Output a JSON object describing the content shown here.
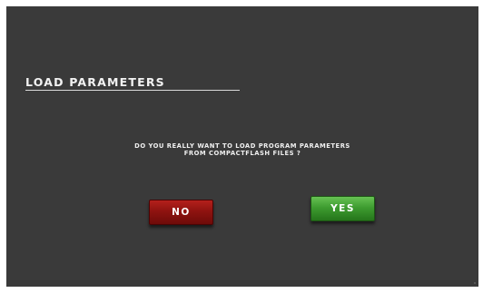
{
  "dialog": {
    "title": "LOAD PARAMETERS",
    "question_line1": "DO YOU REALLY WANT TO LOAD PROGRAM PARAMETERS",
    "question_line2": "FROM COMPACTFLASH FILES ?"
  },
  "buttons": {
    "no_label": "NO",
    "yes_label": "YES"
  },
  "colors": {
    "background": "#3a3a3a",
    "text": "#f2f2f2",
    "no_button": "#8f1310",
    "yes_button": "#3e9c30"
  }
}
